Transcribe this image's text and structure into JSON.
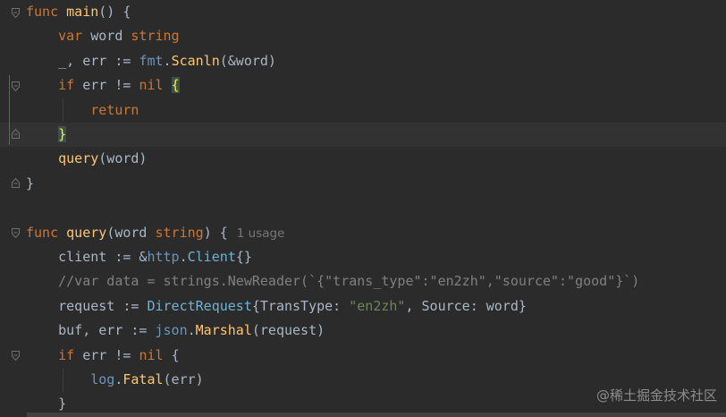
{
  "editor": {
    "language": "Go",
    "lines": [
      {
        "segs": [
          {
            "t": "func ",
            "c": "kw"
          },
          {
            "t": "main",
            "c": "fn"
          },
          {
            "t": "() {",
            "c": ""
          }
        ]
      },
      {
        "segs": [
          {
            "t": "    ",
            "c": ""
          },
          {
            "t": "var ",
            "c": "kw"
          },
          {
            "t": "word ",
            "c": ""
          },
          {
            "t": "string",
            "c": "kw"
          }
        ]
      },
      {
        "segs": [
          {
            "t": "    _, err := ",
            "c": ""
          },
          {
            "t": "fmt",
            "c": "pkg"
          },
          {
            "t": ".",
            "c": ""
          },
          {
            "t": "Scanln",
            "c": "fn"
          },
          {
            "t": "(&word)",
            "c": ""
          }
        ]
      },
      {
        "segs": [
          {
            "t": "    ",
            "c": ""
          },
          {
            "t": "if ",
            "c": "kw"
          },
          {
            "t": "err != ",
            "c": ""
          },
          {
            "t": "nil ",
            "c": "kw"
          },
          {
            "t": "{",
            "c": "brace-hl"
          }
        ]
      },
      {
        "segs": [
          {
            "t": "        ",
            "c": ""
          },
          {
            "t": "return",
            "c": "kw"
          }
        ]
      },
      {
        "segs": [
          {
            "t": "    ",
            "c": ""
          },
          {
            "t": "}",
            "c": "brace-hl"
          }
        ]
      },
      {
        "segs": [
          {
            "t": "    ",
            "c": ""
          },
          {
            "t": "query",
            "c": "fn"
          },
          {
            "t": "(word)",
            "c": ""
          }
        ]
      },
      {
        "segs": [
          {
            "t": "}",
            "c": ""
          }
        ]
      },
      {
        "segs": []
      },
      {
        "segs": [
          {
            "t": "func ",
            "c": "kw"
          },
          {
            "t": "query",
            "c": "fn"
          },
          {
            "t": "(word ",
            "c": ""
          },
          {
            "t": "string",
            "c": "kw"
          },
          {
            "t": ") {",
            "c": ""
          }
        ],
        "inlay": "1 usage"
      },
      {
        "segs": [
          {
            "t": "    client := &",
            "c": ""
          },
          {
            "t": "http",
            "c": "pkg"
          },
          {
            "t": ".",
            "c": ""
          },
          {
            "t": "Client",
            "c": "ty"
          },
          {
            "t": "{}",
            "c": ""
          }
        ]
      },
      {
        "segs": [
          {
            "t": "    //var data = strings.NewReader(`{\"trans_type\":\"en2zh\",\"source\":\"good\"}`)",
            "c": "cm"
          }
        ]
      },
      {
        "segs": [
          {
            "t": "    request := ",
            "c": ""
          },
          {
            "t": "DirectRequest",
            "c": "ty"
          },
          {
            "t": "{TransType: ",
            "c": ""
          },
          {
            "t": "\"en2zh\"",
            "c": "str"
          },
          {
            "t": ", Source: word}",
            "c": ""
          }
        ]
      },
      {
        "segs": [
          {
            "t": "    buf, err := ",
            "c": ""
          },
          {
            "t": "json",
            "c": "pkg"
          },
          {
            "t": ".",
            "c": ""
          },
          {
            "t": "Marshal",
            "c": "fn"
          },
          {
            "t": "(request)",
            "c": ""
          }
        ]
      },
      {
        "segs": [
          {
            "t": "    ",
            "c": ""
          },
          {
            "t": "if ",
            "c": "kw"
          },
          {
            "t": "err != ",
            "c": ""
          },
          {
            "t": "nil ",
            "c": "kw"
          },
          {
            "t": "{",
            "c": ""
          }
        ]
      },
      {
        "segs": [
          {
            "t": "        ",
            "c": ""
          },
          {
            "t": "log",
            "c": "pkg"
          },
          {
            "t": ".",
            "c": ""
          },
          {
            "t": "Fatal",
            "c": "fn"
          },
          {
            "t": "(err)",
            "c": ""
          }
        ]
      },
      {
        "segs": [
          {
            "t": "    }",
            "c": ""
          }
        ]
      }
    ],
    "current_line_index": 5
  },
  "watermark": "@稀土掘金技术社区",
  "colors": {
    "background": "#2b2b2b",
    "keyword": "#cc7832",
    "function": "#ffc66d",
    "package": "#6897bb",
    "type": "#6fb3d2",
    "string": "#6a8759",
    "comment": "#808080",
    "text": "#a9b7c6",
    "brace_match": "#ffef28"
  }
}
